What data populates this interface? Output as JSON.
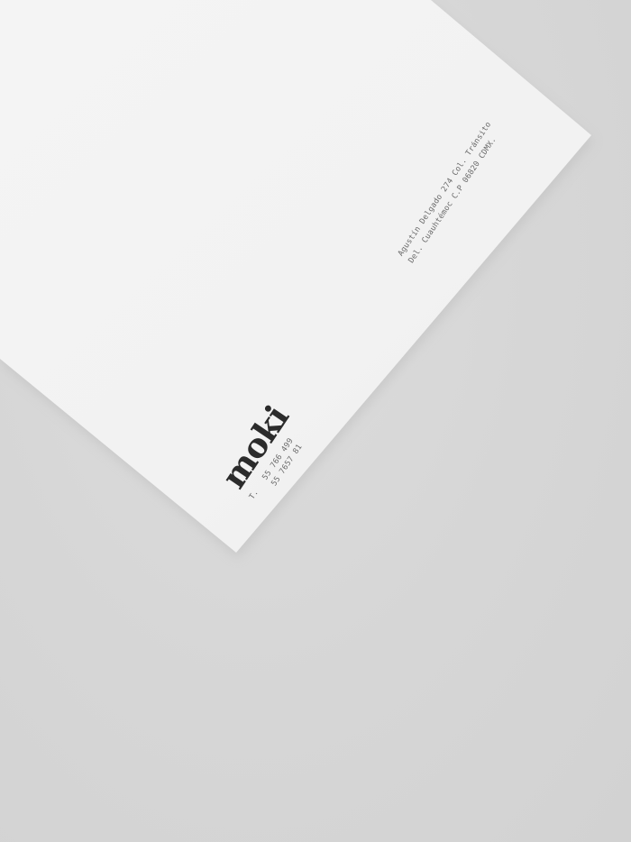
{
  "scene": {
    "colors": {
      "background": "#d7d7d7",
      "paper": "#f3f3f3",
      "logo": "#2b2b2b",
      "small_text": "#6a6a6a"
    }
  },
  "letterhead": {
    "logo_text": "moki",
    "phone_prefix": "T.",
    "phone_1": "55 766 499",
    "phone_2": "55 7657 81",
    "address_line_1": "Agustín Delgado 274 Col. Tránsito",
    "address_line_2": "Del. Cuauhtémoc C.P 06820 CDMX."
  }
}
